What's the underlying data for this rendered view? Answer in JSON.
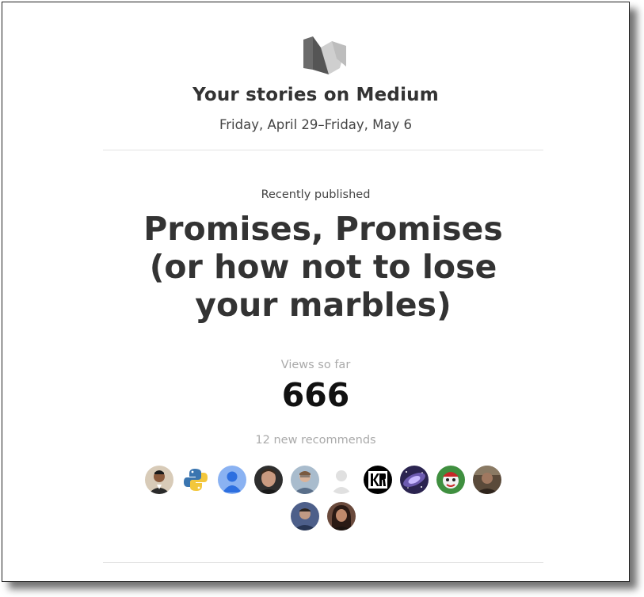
{
  "email": {
    "logo_icon": "medium-logo-icon",
    "header_title": "Your stories on Medium",
    "header_dates": "Friday, April 29–Friday, May 6",
    "recent_label": "Recently published",
    "story_title": "Promises, Promises (or how not to lose your marbles)",
    "views_label": "Views so far",
    "views_count": "666",
    "recommends_label": "12 new recommends",
    "avatars": [
      {
        "icon": "person-photo-icon",
        "bg": "#5a4a3c"
      },
      {
        "icon": "python-logo-icon",
        "bg": "#ffffff"
      },
      {
        "icon": "default-google-avatar-icon",
        "bg": "#7fa9f0"
      },
      {
        "icon": "person-photo-icon",
        "bg": "#3b3b3b"
      },
      {
        "icon": "person-photo-icon",
        "bg": "#8aa1b8"
      },
      {
        "icon": "placeholder-person-icon",
        "bg": "#ffffff"
      },
      {
        "icon": "kr-monogram-icon",
        "bg": "#000000"
      },
      {
        "icon": "galaxy-image-icon",
        "bg": "#3a3060"
      },
      {
        "icon": "cartoon-character-icon",
        "bg": "#3a7a3a"
      },
      {
        "icon": "person-photo-icon",
        "bg": "#4a3c30"
      },
      {
        "icon": "person-photo-icon",
        "bg": "#3c4a70"
      },
      {
        "icon": "person-photo-icon",
        "bg": "#4a3028"
      }
    ]
  }
}
